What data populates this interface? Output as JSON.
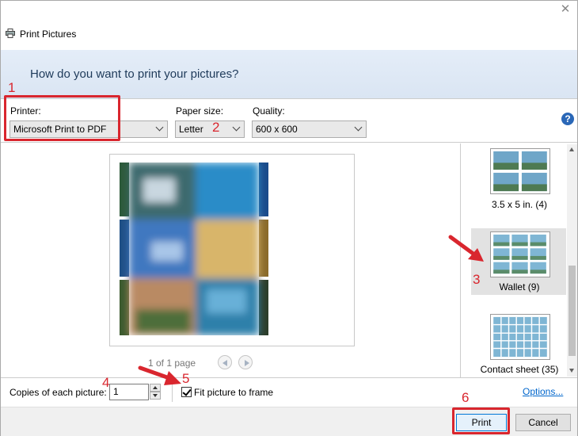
{
  "window": {
    "title": "Print Pictures",
    "close_glyph": "✕"
  },
  "header": {
    "question": "How do you want to print your pictures?"
  },
  "printer": {
    "label": "Printer:",
    "value": "Microsoft Print to PDF"
  },
  "paper_size": {
    "label": "Paper size:",
    "value": "Letter"
  },
  "quality": {
    "label": "Quality:",
    "value": "600 x 600"
  },
  "help_glyph": "?",
  "preview": {
    "page_text": "1 of 1 page"
  },
  "layouts": [
    {
      "caption": "3.5 x 5 in. (4)",
      "selected": false
    },
    {
      "caption": "Wallet (9)",
      "selected": true
    },
    {
      "caption": "Contact sheet (35)",
      "selected": false
    }
  ],
  "copies": {
    "label": "Copies of each picture:",
    "value": "1"
  },
  "fit": {
    "label": "Fit picture to frame",
    "checked": true
  },
  "options_link": "Options...",
  "buttons": {
    "print": "Print",
    "cancel": "Cancel"
  },
  "annotations": {
    "n1": "1",
    "n2": "2",
    "n3": "3",
    "n4": "4",
    "n5": "5",
    "n6": "6",
    "color": "#d9262e"
  },
  "icons": [
    "printer-icon",
    "help-icon",
    "prev-page-icon",
    "next-page-icon",
    "close-icon"
  ]
}
